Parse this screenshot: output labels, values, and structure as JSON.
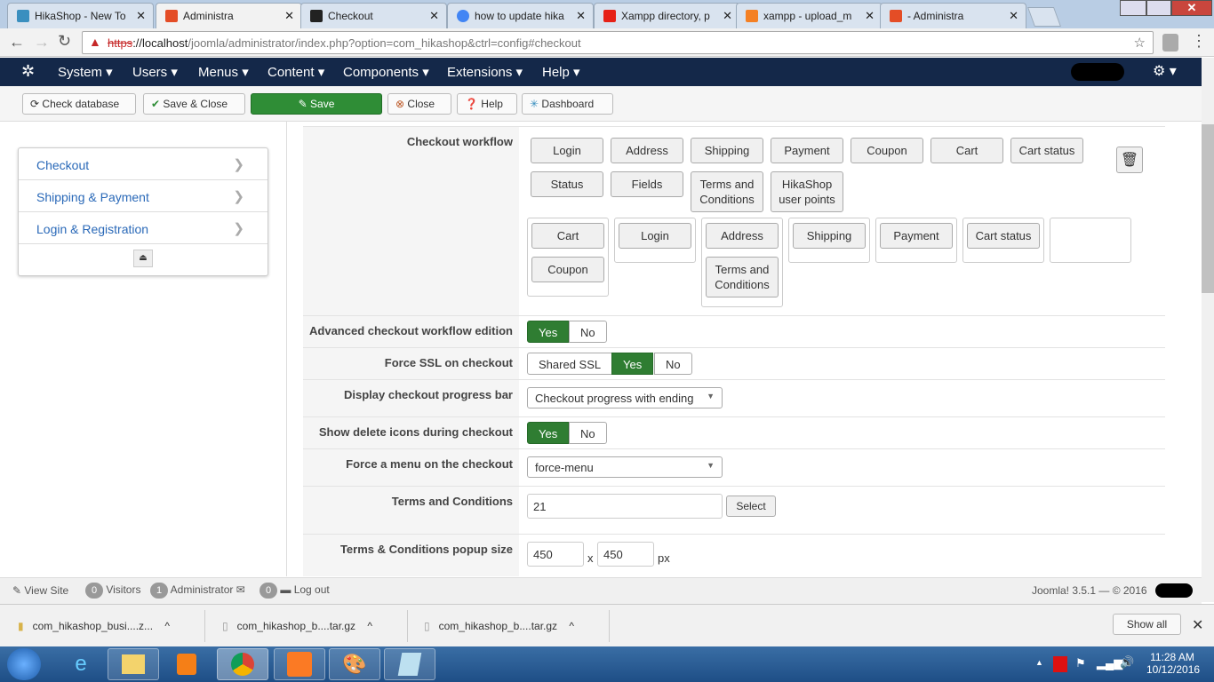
{
  "browser": {
    "tabs": [
      {
        "title": "HikaShop - New To",
        "color": "#3a8fbf"
      },
      {
        "title": "Administra",
        "color": "#e44d26",
        "active": true
      },
      {
        "title": "Checkout",
        "color": "#222"
      },
      {
        "title": "how to update hika",
        "color": "#4285f4"
      },
      {
        "title": "Xampp directory, p",
        "color": "#e62117"
      },
      {
        "title": "xampp - upload_m",
        "color": "#f48024"
      },
      {
        "title": "- Administra",
        "color": "#e44d26"
      }
    ],
    "url_scheme": "https",
    "url_host": "://localhost",
    "url_path": "/joomla/administrator/index.php?option=com_hikashop&ctrl=config#checkout"
  },
  "nav": {
    "items": [
      "System",
      "Users",
      "Menus",
      "Content",
      "Components",
      "Extensions",
      "Help"
    ]
  },
  "toolbar": {
    "check_database": "Check database",
    "save_close": "Save & Close",
    "save": "Save",
    "close": "Close",
    "help": "Help",
    "dashboard": "Dashboard"
  },
  "sidebar": {
    "items": [
      "Checkout",
      "Shipping & Payment",
      "Login & Registration"
    ]
  },
  "config": {
    "workflow_label": "Checkout workflow",
    "available": [
      "Login",
      "Address",
      "Shipping",
      "Payment",
      "Coupon",
      "Cart",
      "Cart status",
      "Status",
      "Fields",
      "Terms and Conditions",
      "HikaShop user points"
    ],
    "steps": [
      [
        "Cart",
        "Coupon"
      ],
      [
        "Login"
      ],
      [
        "Address",
        "Terms and Conditions"
      ],
      [
        "Shipping"
      ],
      [
        "Payment"
      ],
      [
        "Cart status"
      ],
      []
    ],
    "advanced_label": "Advanced checkout workflow edition",
    "advanced_value": "Yes",
    "ssl_label": "Force SSL on checkout",
    "ssl_options": [
      "Shared SSL",
      "Yes",
      "No"
    ],
    "ssl_value": "Yes",
    "progress_label": "Display checkout progress bar",
    "progress_value": "Checkout progress with ending",
    "delete_icons_label": "Show delete icons during checkout",
    "delete_icons_value": "Yes",
    "menu_label": "Force a menu on the checkout",
    "menu_value": "force-menu",
    "terms_label": "Terms and Conditions",
    "terms_value": "21",
    "terms_select": "Select",
    "popup_label": "Terms & Conditions popup size",
    "popup_w": "450",
    "popup_h": "450",
    "popup_x": "x",
    "popup_unit": "px",
    "yes": "Yes",
    "no": "No"
  },
  "footer": {
    "view_site": "View Site",
    "visitors_count": "0",
    "visitors": "Visitors",
    "admin_count": "1",
    "admin": "Administrator",
    "msg_count": "0",
    "logout": "Log out",
    "version": "Joomla! 3.5.1 — © 2016"
  },
  "downloads": {
    "items": [
      "com_hikashop_busi....z...",
      "com_hikashop_b....tar.gz",
      "com_hikashop_b....tar.gz"
    ],
    "show_all": "Show all"
  },
  "taskbar": {
    "time": "11:28 AM",
    "date": "10/12/2016"
  },
  "colors": {
    "navbar": "#142849",
    "save_green": "#2f8d36",
    "toggle_on": "#2f7d32",
    "link": "#2a69b8"
  }
}
